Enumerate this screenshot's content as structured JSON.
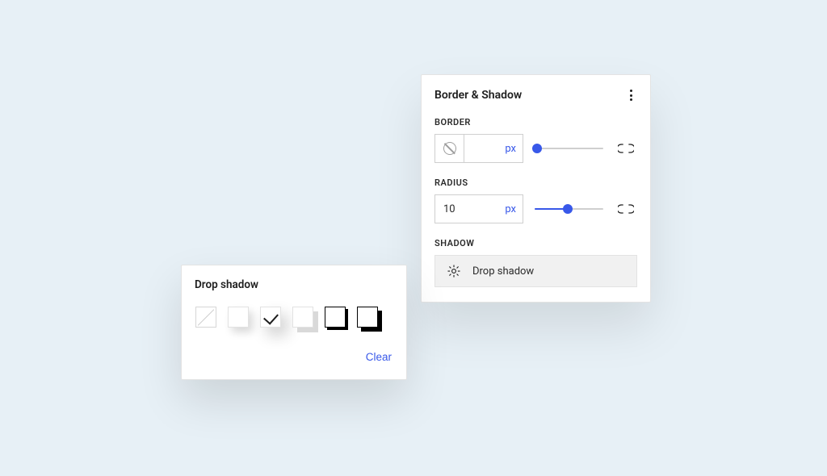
{
  "panel": {
    "title": "Border & Shadow",
    "border": {
      "label": "BORDER",
      "value": "",
      "unit": "px",
      "sliderPercent": 4
    },
    "radius": {
      "label": "RADIUS",
      "value": "10",
      "unit": "px",
      "sliderPercent": 48
    },
    "shadow": {
      "label": "SHADOW",
      "buttonText": "Drop shadow"
    }
  },
  "popover": {
    "title": "Drop shadow",
    "presets": {
      "none": "no-shadow",
      "soft": "soft-shadow",
      "selected": "medium-soft-shadow",
      "gray": "offset-gray-shadow",
      "thin": "offset-black-thin",
      "thick": "offset-black-thick"
    },
    "clear": "Clear"
  },
  "colors": {
    "accent": "#3858e9"
  }
}
